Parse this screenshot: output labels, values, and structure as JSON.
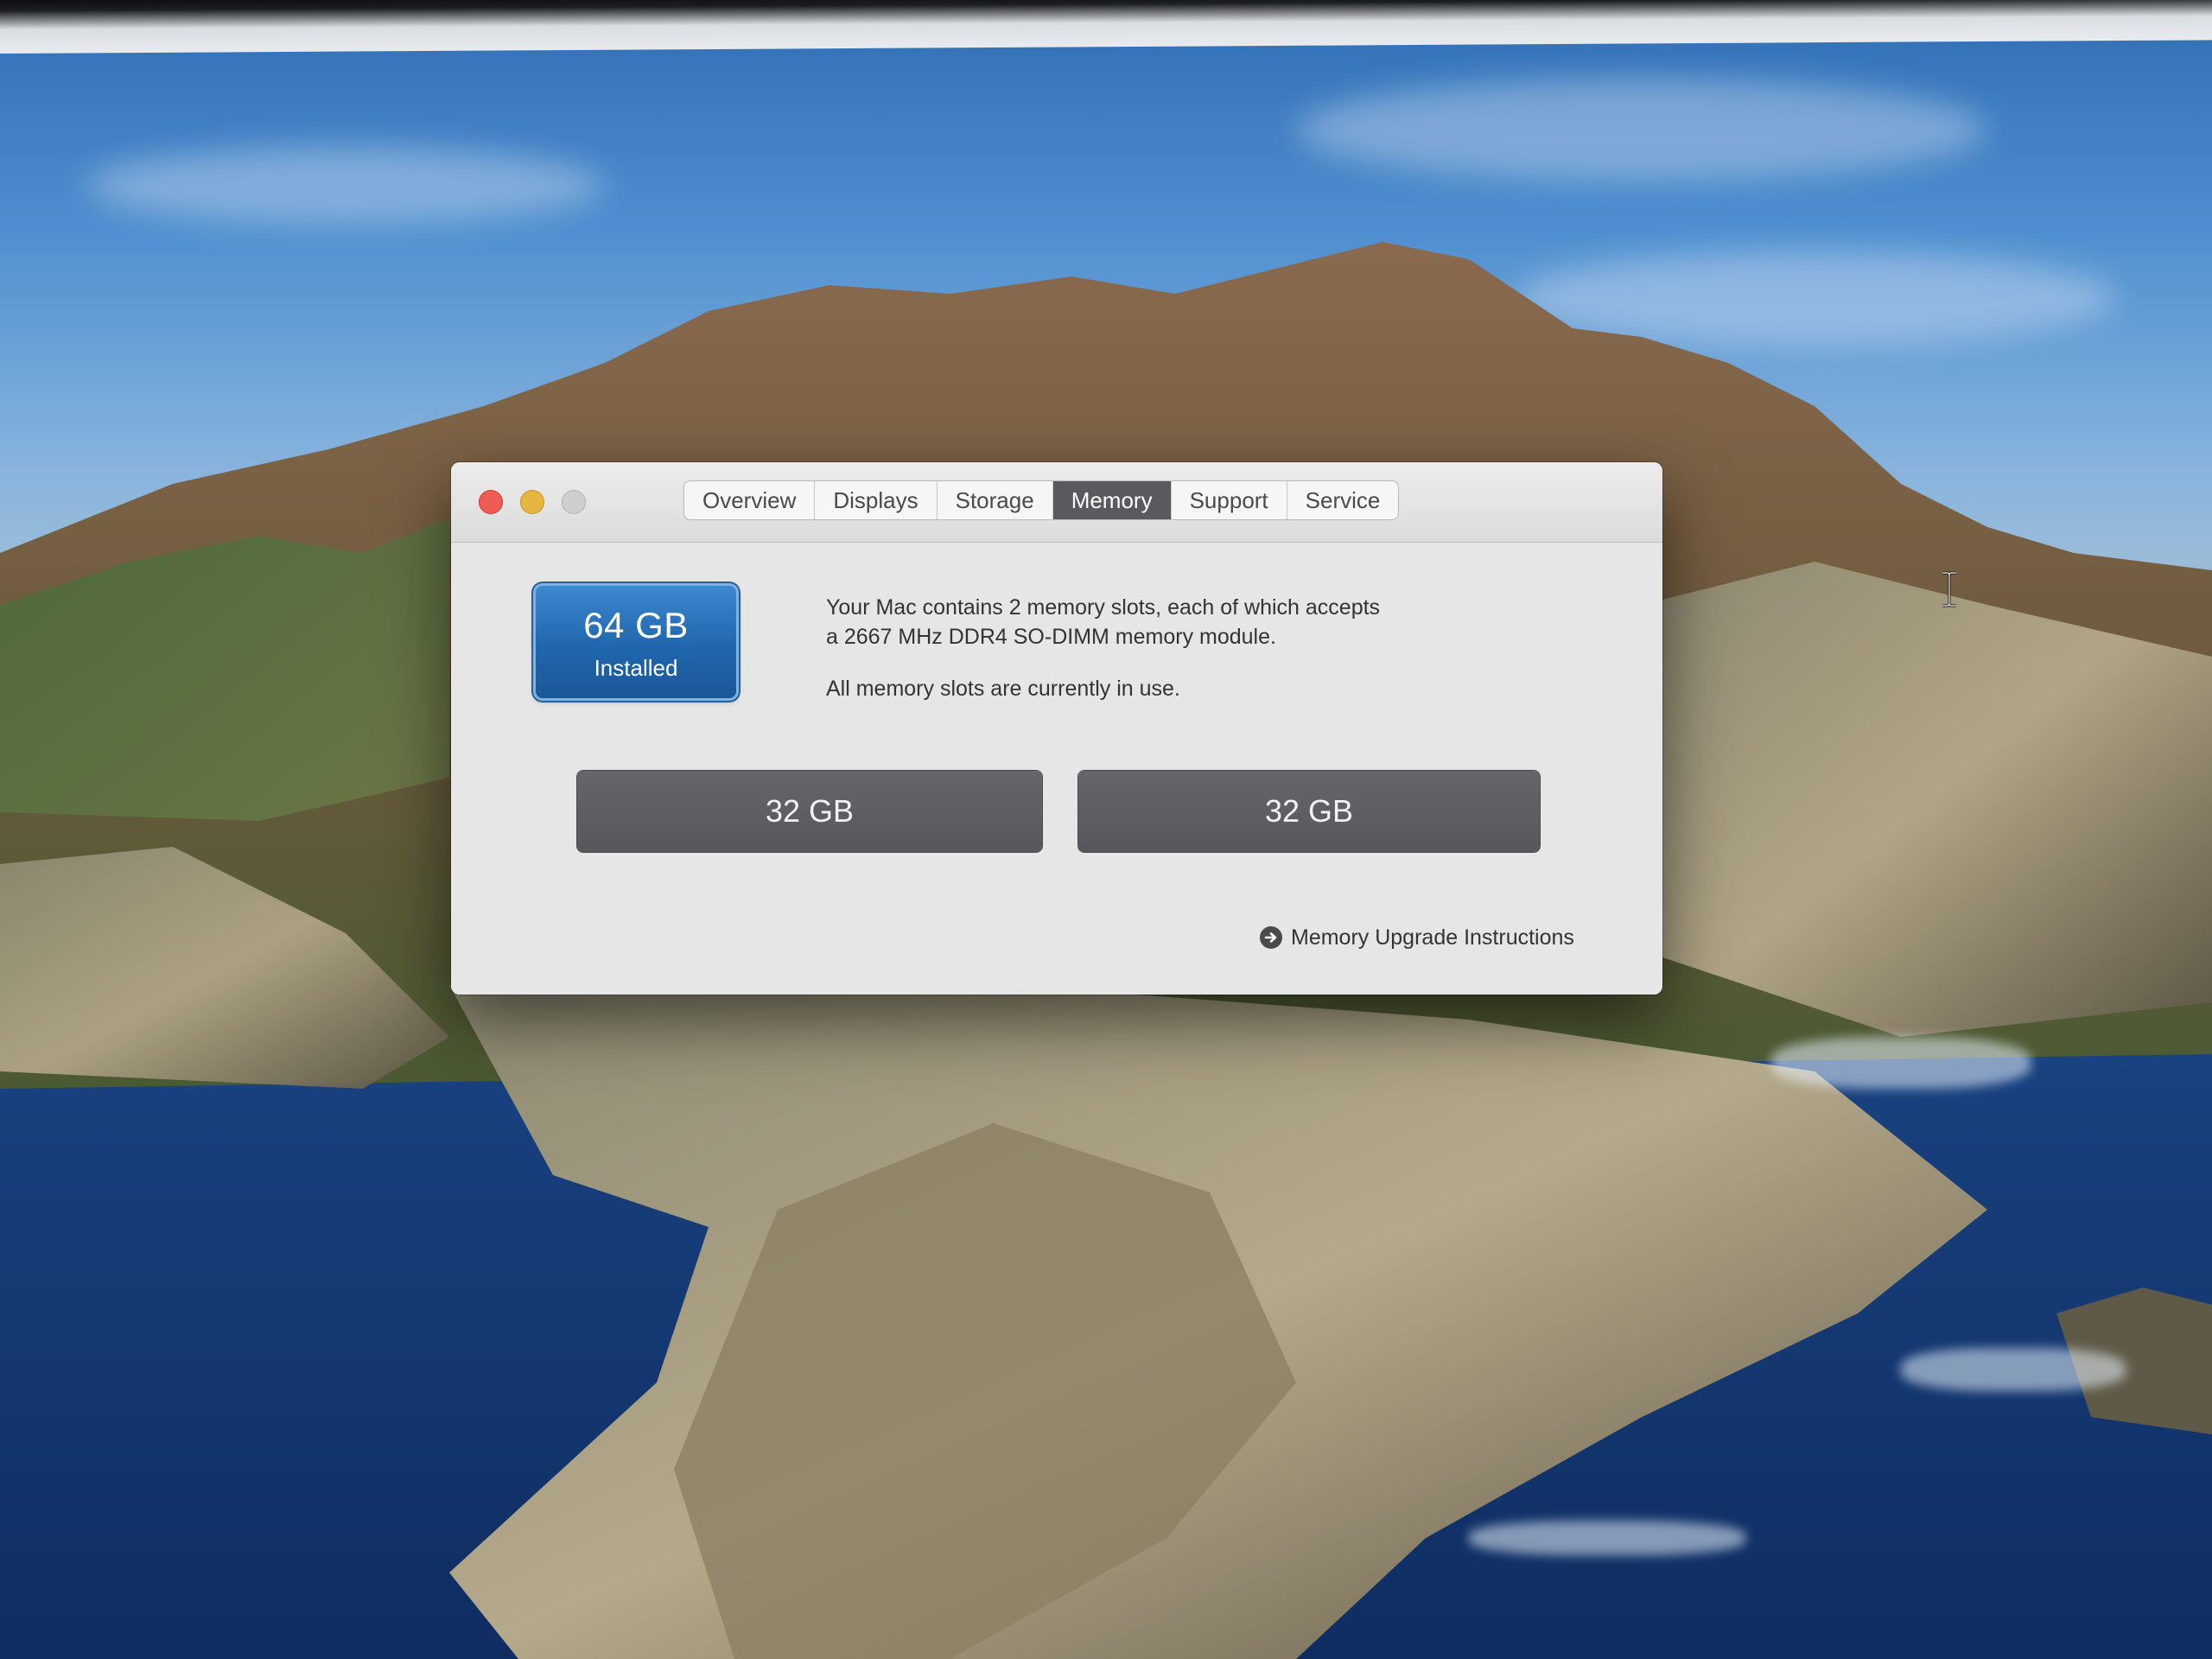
{
  "window": {
    "tabs": [
      {
        "label": "Overview"
      },
      {
        "label": "Displays"
      },
      {
        "label": "Storage"
      },
      {
        "label": "Memory"
      },
      {
        "label": "Support"
      },
      {
        "label": "Service"
      }
    ],
    "active_tab": "Memory"
  },
  "memory": {
    "installed_size": "64 GB",
    "installed_label": "Installed",
    "description_line1": "Your Mac contains 2 memory slots, each of which accepts",
    "description_line2": "a 2667 MHz DDR4 SO-DIMM memory module.",
    "status": "All memory slots are currently in use.",
    "slots": [
      {
        "size": "32 GB"
      },
      {
        "size": "32 GB"
      }
    ],
    "upgrade_link": "Memory Upgrade Instructions"
  },
  "colors": {
    "active_tab": "#5a5a5e",
    "badge_blue": "#1f66ad",
    "slot_gray": "#5c5c60",
    "close": "#ee5b52",
    "minimize": "#e6b640",
    "zoom_disabled": "#cfcfcf"
  },
  "icons": {
    "traffic_close": "close-icon",
    "traffic_minimize": "minimize-icon",
    "traffic_zoom": "zoom-icon",
    "link_arrow": "arrow-right-circle-icon",
    "cursor": "text-cursor-icon"
  }
}
